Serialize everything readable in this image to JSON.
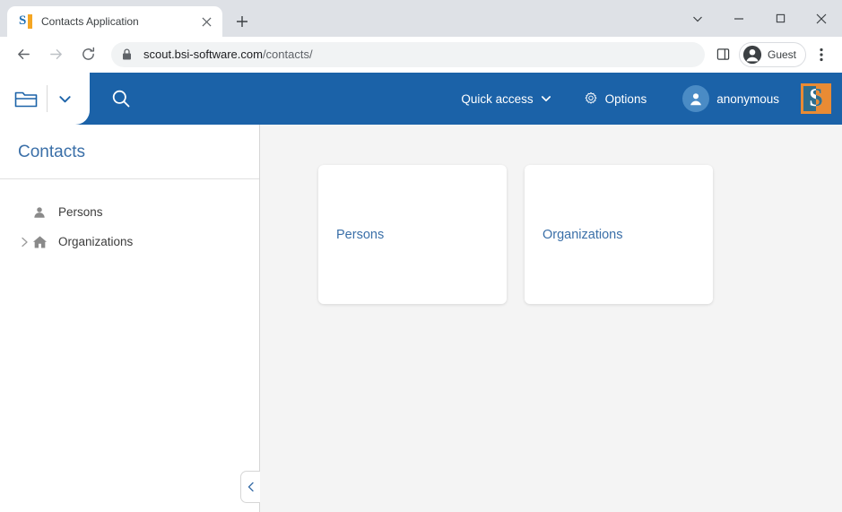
{
  "browser": {
    "tab": {
      "title": "Contacts Application",
      "favicon_name": "scout-favicon",
      "favicon_letter": "S",
      "close_icon": "close-icon"
    },
    "new_tab_label": "+",
    "window_controls": {
      "tab_search": "chevron-down-icon",
      "minimize": "minimize-icon",
      "maximize": "maximize-icon",
      "close": "close-icon"
    },
    "toolbar": {
      "back": "back-arrow-icon",
      "forward": "forward-arrow-icon",
      "reload": "reload-icon",
      "lock": "lock-icon",
      "url_host": "scout.bsi-software.com",
      "url_path": "/contacts/",
      "url_full": "scout.bsi-software.com/contacts/",
      "split_screen": "split-screen-icon",
      "profile_label": "Guest",
      "profile_icon": "person-icon",
      "menu": "three-dot-menu-icon"
    }
  },
  "app": {
    "header": {
      "folder_icon": "folder-icon",
      "dropdown_icon": "chevron-down-icon",
      "search_icon": "search-icon",
      "quick_access_label": "Quick access",
      "quick_access_chevron": "chevron-down-icon",
      "options_icon": "gear-icon",
      "options_label": "Options",
      "user_avatar_icon": "person-icon",
      "user_label": "anonymous",
      "logo_name": "scout-logo",
      "logo_letter": "S",
      "bar_color": "#1b62a8"
    },
    "sidebar": {
      "title": "Contacts",
      "items": [
        {
          "label": "Persons",
          "icon": "person-icon",
          "has_expander": false,
          "expander": ""
        },
        {
          "label": "Organizations",
          "icon": "home-icon",
          "has_expander": true,
          "expander": "chevron-right-icon"
        }
      ],
      "collapse_icon": "chevron-left-icon"
    },
    "content": {
      "cards": [
        {
          "label": "Persons"
        },
        {
          "label": "Organizations"
        }
      ],
      "background_color": "#f4f4f4"
    }
  },
  "colors": {
    "header_blue": "#1b62a8",
    "link_blue": "#3a6fa8",
    "logo_orange": "#e98b34",
    "logo_teal": "#2e6e8e",
    "content_gray": "#f4f4f4"
  }
}
